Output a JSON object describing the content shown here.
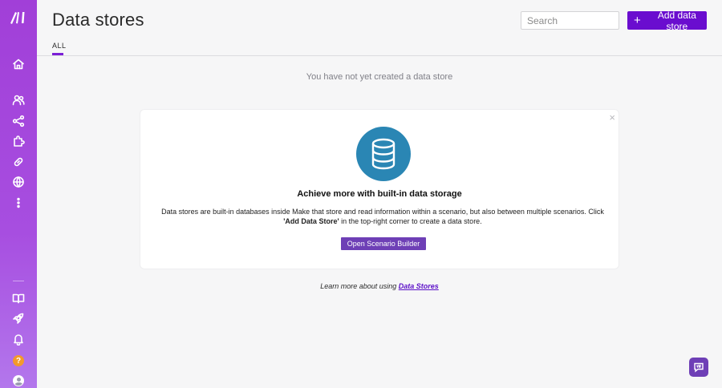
{
  "sidebar": {
    "items": [
      {
        "name": "home-icon"
      },
      {
        "name": "team-icon"
      },
      {
        "name": "scenarios-icon"
      },
      {
        "name": "apps-icon"
      },
      {
        "name": "connections-icon"
      },
      {
        "name": "webhooks-icon"
      },
      {
        "name": "more-icon"
      }
    ],
    "bottom_items": [
      {
        "name": "book-icon"
      },
      {
        "name": "rocket-icon"
      },
      {
        "name": "bell-icon"
      }
    ],
    "help_glyph": "?"
  },
  "header": {
    "title": "Data stores",
    "tab_all": "ALL",
    "search_placeholder": "Search",
    "add_button": "Add data store",
    "add_icon": "plus-icon"
  },
  "main": {
    "empty_message": "You have not yet created a data store",
    "card": {
      "icon": "database-icon",
      "close_glyph": "×",
      "title": "Achieve more with built-in data storage",
      "desc_part1": "Data stores are built-in databases inside Make that store and read information within a scenario, but also between multiple scenarios. Click ",
      "desc_bold": "'Add Data Store'",
      "desc_part2": " in the top-right corner to create a data store.",
      "button": "Open Scenario Builder"
    },
    "learn_more_text": "Learn more about using ",
    "learn_more_link": "Data Stores"
  },
  "colors": {
    "accent": "#6a0dcf",
    "sidebar": "#a13fd8",
    "db_icon_bg": "#2a86b4"
  }
}
